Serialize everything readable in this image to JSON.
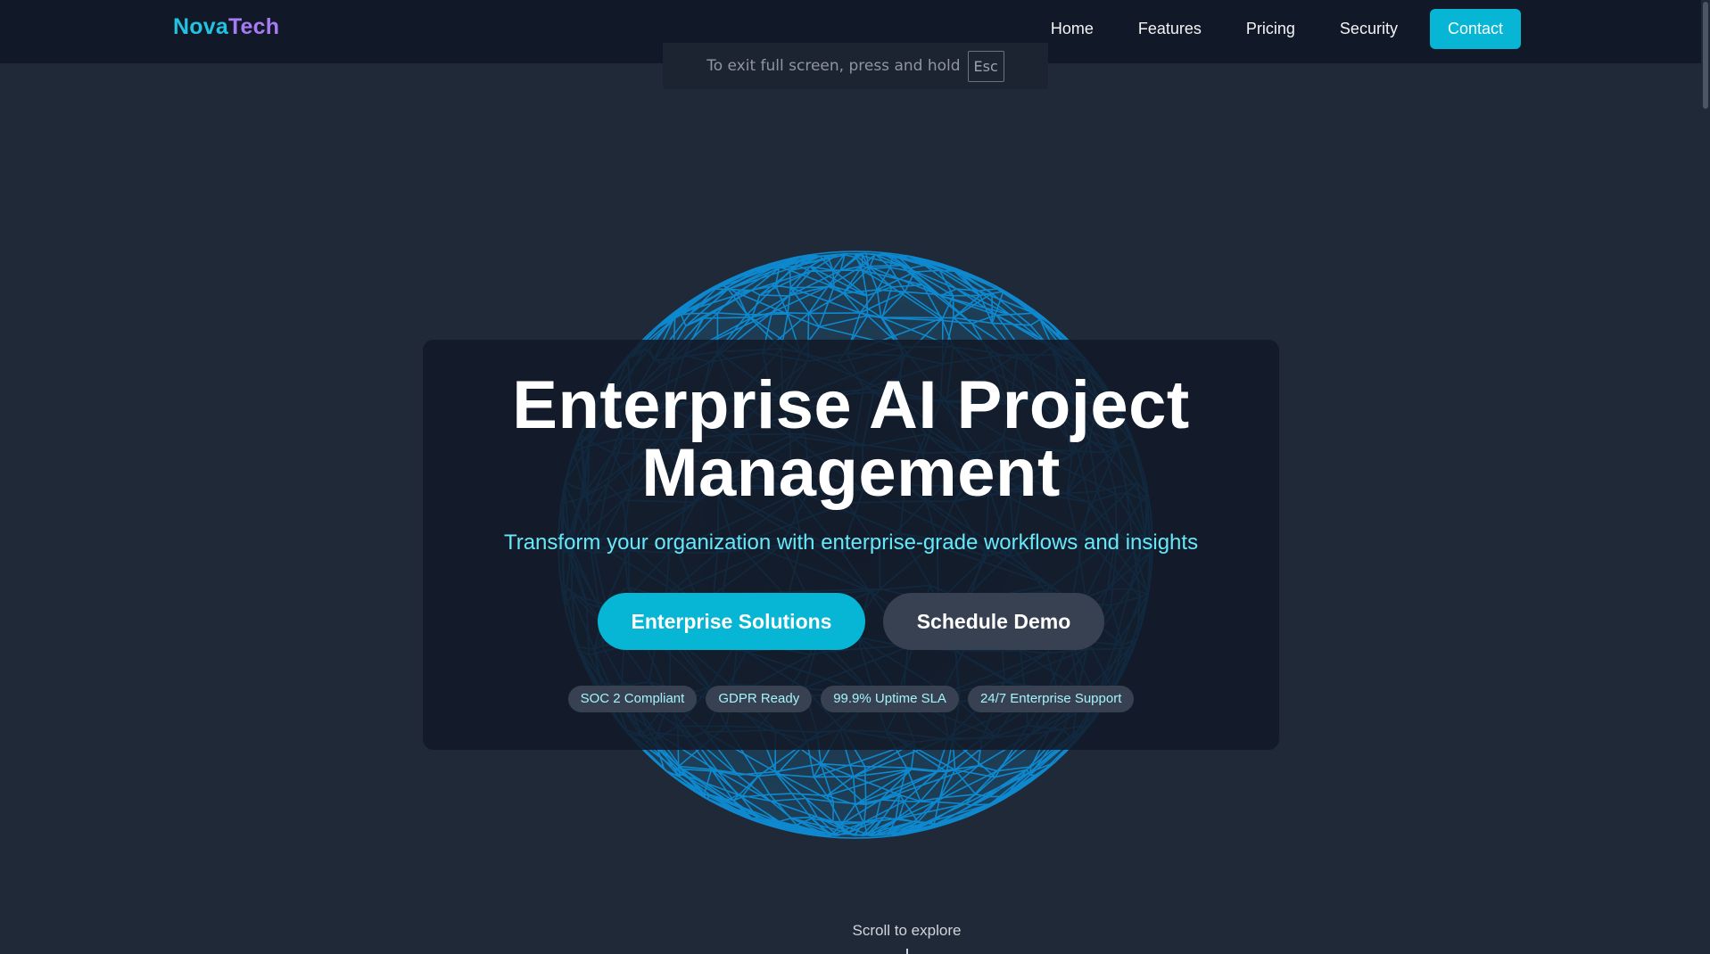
{
  "brand": {
    "part1": "Nova",
    "part2": "Tech",
    "color1": "#22c3e0",
    "color2": "#a77bf3"
  },
  "nav": {
    "links": [
      "Home",
      "Features",
      "Pricing",
      "Security"
    ],
    "contact_label": "Contact"
  },
  "fullscreen_notice": {
    "text": "To exit full screen, press and hold",
    "key": "Esc"
  },
  "hero": {
    "title_line1": "Enterprise AI Project",
    "title_line2": "Management",
    "subtitle": "Transform your organization with enterprise-grade workflows and insights",
    "primary_button": "Enterprise Solutions",
    "secondary_button": "Schedule Demo",
    "badges": [
      "SOC 2 Compliant",
      "GDPR Ready",
      "99.9% Uptime SLA",
      "24/7 Enterprise Support"
    ]
  },
  "scroll_hint": "Scroll to explore",
  "colors": {
    "accent": "#06b6d4",
    "subtitle": "#67e8f9",
    "globe": "#0ea5e9",
    "background": "#202938",
    "navbar": "#111827"
  },
  "visual": {
    "globe_icon": "wireframe-globe"
  }
}
